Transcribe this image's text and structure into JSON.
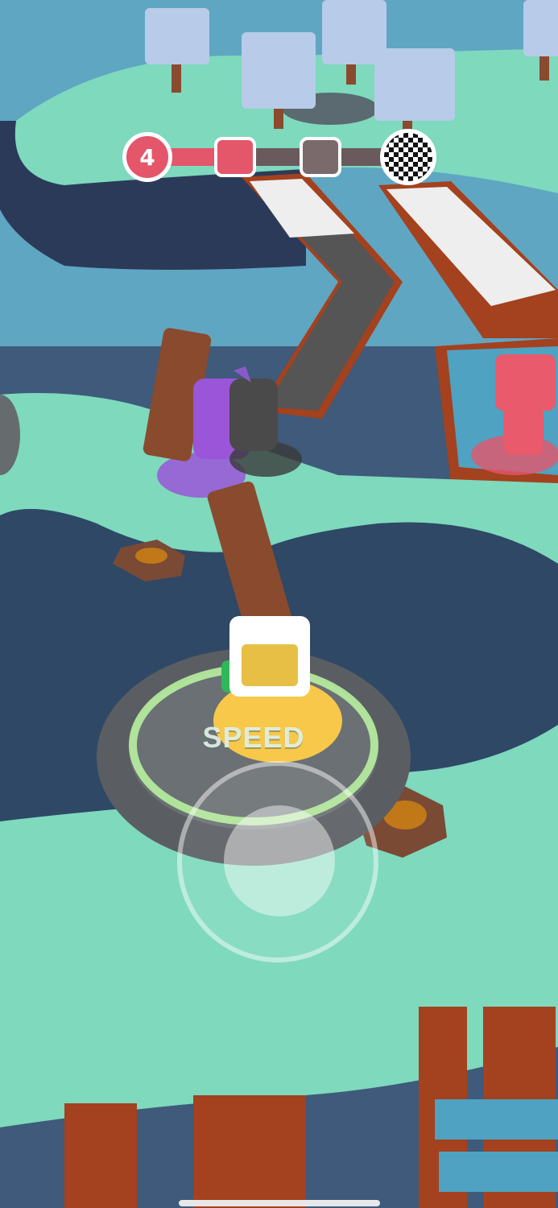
{
  "hud": {
    "level_number": "4",
    "progress_stages_total": 3,
    "progress_stages_completed": 1,
    "active_color": "#e4566a",
    "inactive_color": "#6a5a5e",
    "finish_icon": "checkered-flag-icon"
  },
  "player": {
    "powerup_label": "SPEED"
  },
  "controls": {
    "joystick_icon": "virtual-joystick"
  },
  "colors": {
    "water": "#3f5a7a",
    "grass": "#7ed9bd",
    "bridge_dark": "#555555",
    "bridge_light": "#eeeeee",
    "wood": "#a4411e"
  }
}
